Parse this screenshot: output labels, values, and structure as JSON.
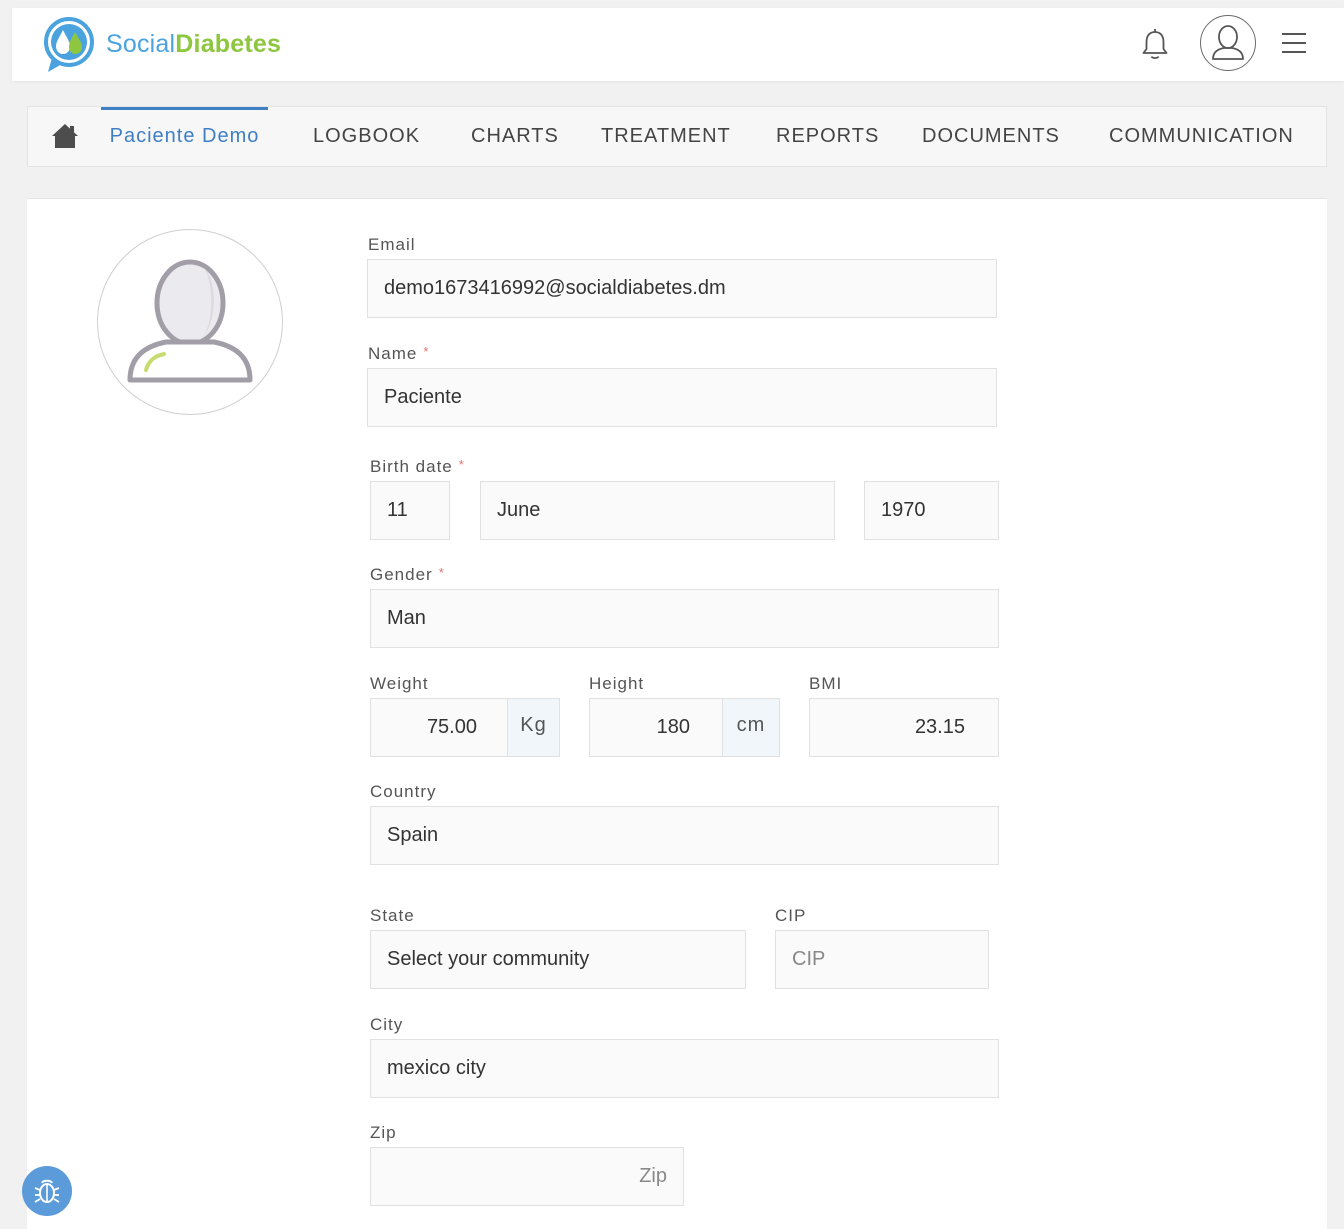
{
  "header": {
    "logo_part1": "Social",
    "logo_part2": "Diabetes"
  },
  "nav": {
    "patient": "Paciente Demo",
    "logbook": "LOGBOOK",
    "charts": "CHARTS",
    "treatment": "TREATMENT",
    "reports": "REPORTS",
    "documents": "DOCUMENTS",
    "communication": "COMMUNICATION"
  },
  "form": {
    "email_label": "Email",
    "email_value": "demo1673416992@socialdiabetes.dm",
    "name_label": "Name",
    "name_value": "Paciente",
    "birth_label": "Birth date",
    "birth_day": "11",
    "birth_month": "June",
    "birth_year": "1970",
    "gender_label": "Gender",
    "gender_value": "Man",
    "weight_label": "Weight",
    "weight_value": "75.00",
    "weight_unit": "Kg",
    "height_label": "Height",
    "height_value": "180",
    "height_unit": "cm",
    "bmi_label": "BMI",
    "bmi_value": "23.15",
    "country_label": "Country",
    "country_value": "Spain",
    "state_label": "State",
    "state_value": "Select your community",
    "cip_label": "CIP",
    "cip_placeholder": "CIP",
    "city_label": "City",
    "city_value": "mexico city",
    "zip_label": "Zip",
    "zip_placeholder": "Zip",
    "required_mark": "*"
  },
  "colors": {
    "brand_blue": "#4aa3df",
    "brand_green": "#8dc63f",
    "active_tab": "#3f7fc4",
    "required": "#e0706a"
  }
}
